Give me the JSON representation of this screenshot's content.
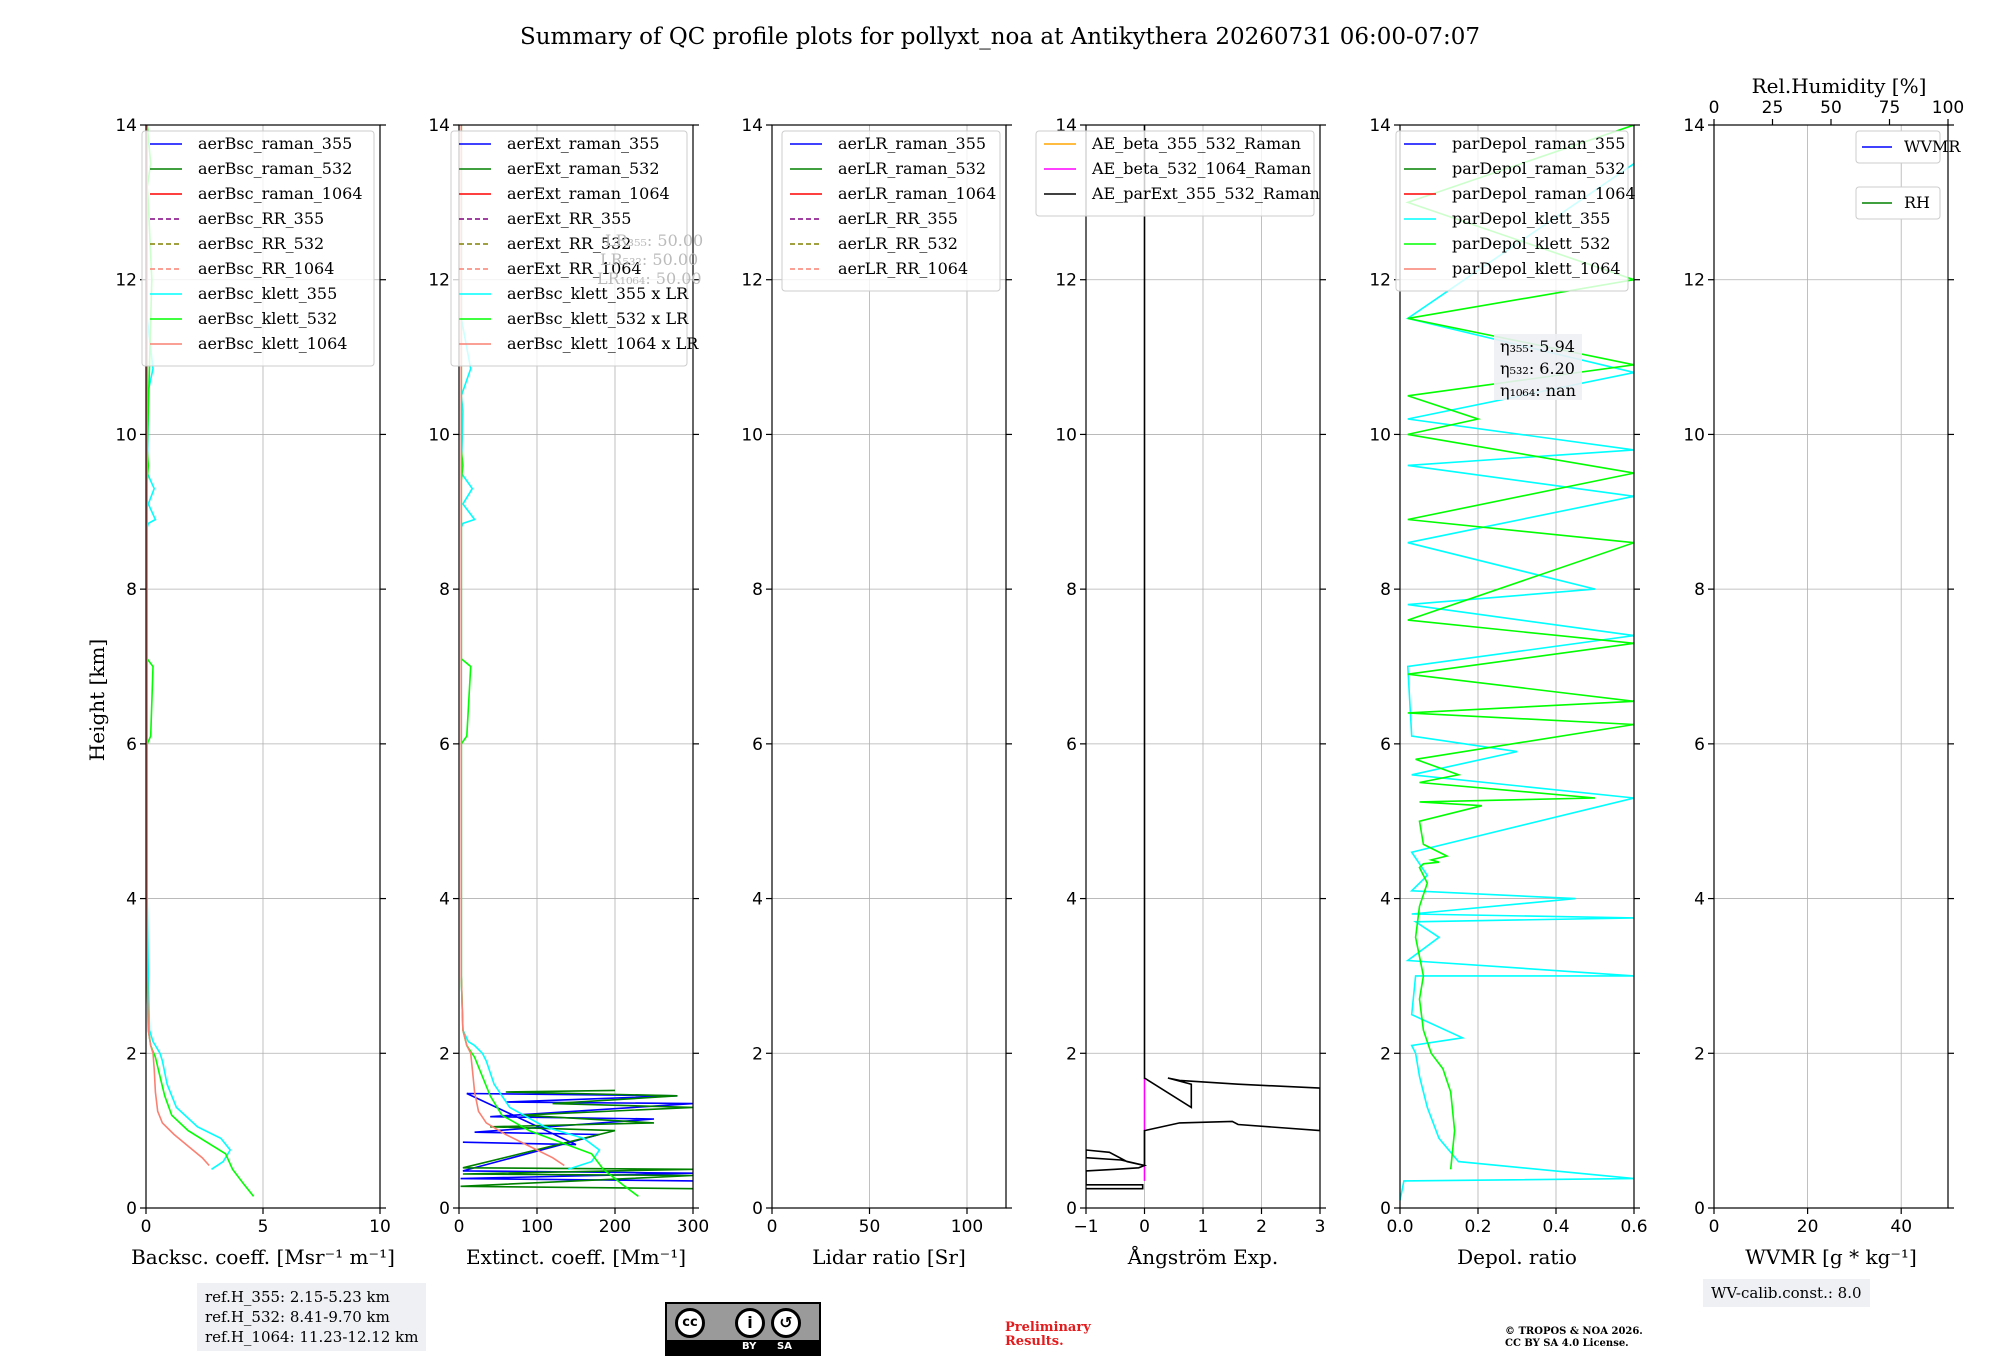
{
  "title": "Summary of QC profile plots for pollyxt_noa at Antikythera 20260731 06:00-07:07",
  "ylabel": "Height [km]",
  "info": {
    "refh": [
      "ref.H_355: 2.15-5.23 km",
      "ref.H_532: 8.41-9.70 km",
      "ref.H_1064: 11.23-12.12 km"
    ],
    "lr_note": [
      "LR₃₅₅: 50.00",
      "LR₅₃₂: 50.00",
      "LR₁₀₆₄: 50.00"
    ],
    "eta": [
      "η₃₅₅: 5.94",
      "η₅₃₂: 6.20",
      "η₁₀₆₄: nan"
    ],
    "wv_calib": "WV-calib.const.: 8.0",
    "preliminary": [
      "Preliminary",
      "Results."
    ],
    "copyright": [
      "© TROPOS & NOA 2026.",
      "CC BY SA 4.0 License."
    ],
    "license_badge": [
      "cc",
      "BY",
      "SA"
    ]
  },
  "colors": {
    "blue": "#0000ff",
    "green": "#008000",
    "red": "#ff0000",
    "purple": "#800080",
    "olive": "#808000",
    "salmon": "#fa8072",
    "cyan": "#00ffff",
    "lime": "#00ff00",
    "orange": "#ffa500",
    "magenta": "#ff00ff",
    "black": "#000000"
  },
  "chart_data": [
    {
      "type": "line",
      "xlabel": "Backsc. coeff. [Msr⁻¹ m⁻¹]",
      "xlim": [
        0,
        10
      ],
      "xticks": [
        0,
        5,
        10
      ],
      "ylim": [
        0,
        14
      ],
      "yticks": [
        0,
        2,
        4,
        6,
        8,
        10,
        12,
        14
      ],
      "grid": true,
      "legend": "top-right",
      "series": [
        {
          "name": "aerBsc_raman_355",
          "color": "blue",
          "dash": false,
          "x": [],
          "y": []
        },
        {
          "name": "aerBsc_raman_532",
          "color": "green",
          "dash": false,
          "x": [],
          "y": []
        },
        {
          "name": "aerBsc_raman_1064",
          "color": "red",
          "dash": false,
          "x": [],
          "y": []
        },
        {
          "name": "aerBsc_RR_355",
          "color": "purple",
          "dash": true,
          "x": [],
          "y": []
        },
        {
          "name": "aerBsc_RR_532",
          "color": "olive",
          "dash": true,
          "x": [],
          "y": []
        },
        {
          "name": "aerBsc_RR_1064",
          "color": "salmon",
          "dash": true,
          "x": [],
          "y": []
        },
        {
          "name": "aerBsc_klett_355",
          "color": "cyan",
          "dash": false,
          "x": [
            2.8,
            3.3,
            3.6,
            3.2,
            2.2,
            1.3,
            0.9,
            0.7,
            0.6,
            0.4,
            0.3,
            0.15,
            0.1,
            0.05,
            0.05,
            0.05,
            0.05,
            0.05,
            0.1,
            0.4,
            0.1,
            0.35,
            0.05,
            0.1,
            0.05,
            0.3,
            0.05,
            0.05
          ],
          "y": [
            0.5,
            0.6,
            0.75,
            0.9,
            1.05,
            1.3,
            1.6,
            1.9,
            2.0,
            2.1,
            2.15,
            2.3,
            3.0,
            4.0,
            6.0,
            7.5,
            8.5,
            8.8,
            8.85,
            8.9,
            9.1,
            9.3,
            9.5,
            10.3,
            10.5,
            10.85,
            11.5,
            13.5
          ]
        },
        {
          "name": "aerBsc_klett_532",
          "color": "lime",
          "dash": false,
          "x": [
            4.6,
            4.2,
            3.7,
            3.4,
            2.6,
            1.8,
            1.1,
            0.8,
            0.6,
            0.4,
            0.2,
            0.1,
            0.05,
            0.05,
            0.2,
            0.3,
            0.05,
            0.05,
            0.1,
            0.05,
            0.25,
            0.1,
            0.05,
            0.2,
            0.05
          ],
          "y": [
            0.15,
            0.3,
            0.5,
            0.7,
            0.85,
            1.0,
            1.2,
            1.45,
            1.7,
            1.95,
            2.1,
            2.3,
            3.0,
            6.0,
            6.1,
            7.0,
            7.1,
            9.4,
            9.6,
            9.8,
            12.0,
            13.0,
            13.2,
            13.5,
            14.0
          ]
        },
        {
          "name": "aerBsc_klett_1064",
          "color": "salmon",
          "dash": false,
          "x": [
            2.7,
            2.4,
            1.8,
            1.2,
            0.7,
            0.5,
            0.4,
            0.35,
            0.3,
            0.2,
            0.1,
            0.05,
            0.05
          ],
          "y": [
            0.55,
            0.65,
            0.8,
            0.95,
            1.1,
            1.25,
            1.5,
            1.8,
            2.0,
            2.1,
            2.3,
            3.0,
            14.0
          ]
        }
      ]
    },
    {
      "type": "line",
      "xlabel": "Extinct. coeff. [Mm⁻¹]",
      "xlim": [
        0,
        300
      ],
      "xticks": [
        0,
        100,
        200,
        300
      ],
      "ylim": [
        0,
        14
      ],
      "yticks": [
        0,
        2,
        4,
        6,
        8,
        10,
        12,
        14
      ],
      "grid": true,
      "legend": "top-right",
      "series": [
        {
          "name": "aerExt_raman_355",
          "color": "blue",
          "dash": false,
          "x": [
            300,
            2,
            300,
            5,
            180,
            20,
            250,
            40,
            300,
            60,
            280,
            10,
            150,
            5
          ],
          "y": [
            0.35,
            0.38,
            0.45,
            0.48,
            0.95,
            0.98,
            1.15,
            1.18,
            1.35,
            1.37,
            1.45,
            1.48,
            0.82,
            0.85
          ]
        },
        {
          "name": "aerExt_raman_532",
          "color": "green",
          "dash": false,
          "x": [
            300,
            2,
            300,
            5,
            300,
            5,
            200,
            40,
            250,
            80,
            300,
            120,
            280,
            60,
            200
          ],
          "y": [
            0.25,
            0.28,
            0.42,
            0.44,
            0.5,
            0.52,
            1.0,
            1.05,
            1.1,
            1.2,
            1.3,
            1.35,
            1.45,
            1.5,
            1.52
          ]
        },
        {
          "name": "aerExt_raman_1064",
          "color": "red",
          "dash": false,
          "x": [],
          "y": []
        },
        {
          "name": "aerExt_RR_355",
          "color": "purple",
          "dash": true,
          "x": [],
          "y": []
        },
        {
          "name": "aerExt_RR_532",
          "color": "olive",
          "dash": true,
          "x": [],
          "y": []
        },
        {
          "name": "aerExt_RR_1064",
          "color": "salmon",
          "dash": true,
          "x": [],
          "y": []
        },
        {
          "name": "aerBsc_klett_355 x LR",
          "color": "cyan",
          "dash": false,
          "x": [
            140,
            170,
            180,
            160,
            110,
            65,
            45,
            35,
            30,
            20,
            12,
            5,
            3,
            3,
            3,
            3,
            5,
            20,
            5,
            17,
            3,
            5,
            3,
            15,
            3,
            3
          ],
          "y": [
            0.5,
            0.6,
            0.75,
            0.9,
            1.05,
            1.3,
            1.6,
            1.9,
            2.0,
            2.1,
            2.15,
            2.3,
            3.0,
            6.0,
            8.5,
            8.8,
            8.85,
            8.9,
            9.1,
            9.3,
            9.5,
            10.3,
            10.5,
            10.85,
            11.5,
            13.5
          ]
        },
        {
          "name": "aerBsc_klett_532 x LR",
          "color": "lime",
          "dash": false,
          "x": [
            230,
            210,
            185,
            170,
            130,
            90,
            55,
            40,
            30,
            20,
            10,
            5,
            3,
            3,
            10,
            15,
            3,
            3,
            5,
            3,
            3
          ],
          "y": [
            0.15,
            0.3,
            0.5,
            0.7,
            0.85,
            1.0,
            1.2,
            1.45,
            1.7,
            1.95,
            2.1,
            2.3,
            3.0,
            6.0,
            6.1,
            7.0,
            7.1,
            9.4,
            9.6,
            9.8,
            14.0
          ]
        },
        {
          "name": "aerBsc_klett_1064 x LR",
          "color": "salmon",
          "dash": false,
          "x": [
            135,
            120,
            90,
            60,
            35,
            25,
            20,
            17,
            15,
            10,
            5,
            3,
            3
          ],
          "y": [
            0.55,
            0.65,
            0.8,
            0.95,
            1.1,
            1.25,
            1.5,
            1.8,
            2.0,
            2.1,
            2.3,
            3.0,
            14.0
          ]
        }
      ]
    },
    {
      "type": "line",
      "xlabel": "Lidar ratio [Sr]",
      "xlim": [
        0,
        120
      ],
      "xticks": [
        0,
        50,
        100
      ],
      "ylim": [
        0,
        14
      ],
      "yticks": [
        0,
        2,
        4,
        6,
        8,
        10,
        12,
        14
      ],
      "grid": true,
      "legend": "top-right",
      "series": [
        {
          "name": "aerLR_raman_355",
          "color": "blue",
          "dash": false,
          "x": [],
          "y": []
        },
        {
          "name": "aerLR_raman_532",
          "color": "green",
          "dash": false,
          "x": [],
          "y": []
        },
        {
          "name": "aerLR_raman_1064",
          "color": "red",
          "dash": false,
          "x": [],
          "y": []
        },
        {
          "name": "aerLR_RR_355",
          "color": "purple",
          "dash": true,
          "x": [],
          "y": []
        },
        {
          "name": "aerLR_RR_532",
          "color": "olive",
          "dash": true,
          "x": [],
          "y": []
        },
        {
          "name": "aerLR_RR_1064",
          "color": "salmon",
          "dash": true,
          "x": [],
          "y": []
        }
      ]
    },
    {
      "type": "line",
      "xlabel": "Ångström Exp.",
      "xlim": [
        -1,
        3
      ],
      "xticks": [
        -1,
        0,
        1,
        2,
        3
      ],
      "ylim": [
        0,
        14
      ],
      "yticks": [
        0,
        2,
        4,
        6,
        8,
        10,
        12,
        14
      ],
      "grid": true,
      "legend": "top-right",
      "series": [
        {
          "name": "AE_beta_355_532_Raman",
          "color": "orange",
          "dash": false,
          "x": [],
          "y": []
        },
        {
          "name": "AE_beta_532_1064_Raman",
          "color": "magenta",
          "dash": false,
          "x": [
            0,
            0,
            0
          ],
          "y": [
            0.35,
            1.0,
            1.68
          ]
        },
        {
          "name": "AE_parExt_355_532_Raman",
          "color": "black",
          "dash": false,
          "x": [
            -1,
            -0.03,
            -0.03,
            -1,
            -1,
            -0.5,
            -0.1,
            0,
            -0.4,
            -1,
            -1,
            -0.6,
            -0.3,
            0,
            0,
            0.6,
            1.5,
            1.6,
            3,
            3,
            1.6,
            0.6,
            0.4,
            0.8,
            0.8,
            0,
            0,
            0,
            0
          ],
          "y": [
            0.25,
            0.25,
            0.3,
            0.3,
            0.48,
            0.5,
            0.52,
            0.55,
            0.62,
            0.65,
            0.75,
            0.72,
            0.6,
            0.55,
            1.0,
            1.1,
            1.12,
            1.08,
            1.0,
            1.55,
            1.6,
            1.65,
            1.68,
            1.6,
            1.3,
            1.68,
            1.69,
            13.0,
            14.0
          ]
        }
      ]
    },
    {
      "type": "line",
      "xlabel": "Depol. ratio",
      "xlim": [
        0,
        0.6
      ],
      "xticks": [
        0.0,
        0.2,
        0.4,
        0.6
      ],
      "ylim": [
        0,
        14
      ],
      "yticks": [
        0,
        2,
        4,
        6,
        8,
        10,
        12,
        14
      ],
      "grid": true,
      "legend": "top-right",
      "series": [
        {
          "name": "parDepol_raman_355",
          "color": "blue",
          "dash": false,
          "x": [],
          "y": []
        },
        {
          "name": "parDepol_raman_532",
          "color": "green",
          "dash": false,
          "x": [],
          "y": []
        },
        {
          "name": "parDepol_raman_1064",
          "color": "red",
          "dash": false,
          "x": [],
          "y": []
        },
        {
          "name": "parDepol_klett_355",
          "color": "cyan",
          "dash": false,
          "x": [
            0.0,
            0.01,
            0.6,
            0.15,
            0.1,
            0.07,
            0.05,
            0.04,
            0.03,
            0.16,
            0.03,
            0.04,
            0.6,
            0.02,
            0.1,
            0.04,
            0.6,
            0.03,
            0.45,
            0.03,
            0.07,
            0.03,
            0.6,
            0.03,
            0.3,
            0.03,
            0.02,
            0.6,
            0.02,
            0.5,
            0.02,
            0.6,
            0.02,
            0.6,
            0.02,
            0.6,
            0.02,
            0.6
          ],
          "y": [
            0.1,
            0.35,
            0.38,
            0.6,
            0.9,
            1.3,
            1.7,
            2.0,
            2.1,
            2.2,
            2.5,
            3.0,
            3.0,
            3.2,
            3.5,
            3.7,
            3.75,
            3.8,
            4.0,
            4.1,
            4.3,
            4.6,
            5.3,
            5.6,
            5.9,
            6.1,
            7.0,
            7.4,
            7.8,
            8.0,
            8.6,
            9.2,
            9.6,
            9.8,
            10.2,
            10.8,
            11.5,
            13.5
          ]
        },
        {
          "name": "parDepol_klett_532",
          "color": "lime",
          "dash": false,
          "x": [
            0.13,
            0.14,
            0.13,
            0.11,
            0.08,
            0.06,
            0.05,
            0.06,
            0.04,
            0.05,
            0.07,
            0.05,
            0.06,
            0.1,
            0.08,
            0.12,
            0.06,
            0.05,
            0.21,
            0.05,
            0.5,
            0.05,
            0.15,
            0.04,
            0.6,
            0.02,
            0.6,
            0.02,
            0.6,
            0.02,
            0.6,
            0.02,
            0.6,
            0.02,
            0.2,
            0.02,
            0.6,
            0.02,
            0.6,
            0.02,
            0.6
          ],
          "y": [
            0.5,
            1.0,
            1.5,
            1.8,
            2.0,
            2.3,
            2.7,
            3.0,
            3.5,
            3.9,
            4.2,
            4.4,
            4.45,
            4.47,
            4.5,
            4.55,
            4.7,
            5.0,
            5.2,
            5.25,
            5.3,
            5.5,
            5.6,
            5.8,
            6.25,
            6.4,
            6.55,
            6.9,
            7.3,
            7.6,
            8.6,
            8.9,
            9.5,
            10.0,
            10.2,
            10.5,
            10.9,
            11.5,
            12.0,
            13.0,
            14.0
          ]
        },
        {
          "name": "parDepol_klett_1064",
          "color": "salmon",
          "dash": false,
          "x": [],
          "y": []
        }
      ]
    },
    {
      "type": "line",
      "xlabel": "WVMR [g * kg⁻¹]",
      "x2label": "Rel.Humidity [%]",
      "xlim": [
        0,
        50
      ],
      "xticks": [
        0,
        20,
        40
      ],
      "x2lim": [
        0,
        100
      ],
      "x2ticks": [
        0,
        25,
        50,
        75,
        100
      ],
      "ylim": [
        0,
        14
      ],
      "yticks": [
        0,
        2,
        4,
        6,
        8,
        10,
        12,
        14
      ],
      "grid": true,
      "legend": "top-right",
      "series": [
        {
          "name": "WVMR",
          "color": "blue",
          "dash": false,
          "x": [],
          "y": []
        },
        {
          "name": "RH",
          "color": "green",
          "dash": false,
          "x": [],
          "y": []
        }
      ]
    }
  ]
}
